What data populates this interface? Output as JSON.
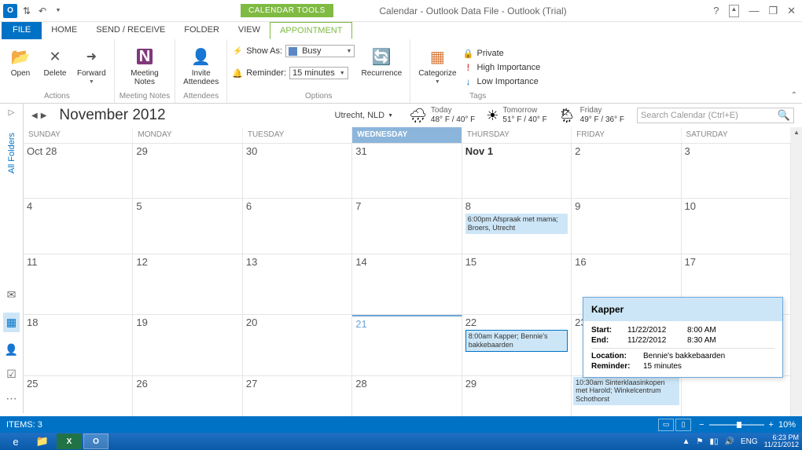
{
  "window": {
    "title": "Calendar - Outlook Data File - Outlook (Trial)",
    "context_tab": "CALENDAR TOOLS"
  },
  "tabs": {
    "file": "FILE",
    "home": "HOME",
    "send_receive": "SEND / RECEIVE",
    "folder": "FOLDER",
    "view": "VIEW",
    "appointment": "APPOINTMENT"
  },
  "ribbon": {
    "actions": {
      "open": "Open",
      "delete": "Delete",
      "forward": "Forward",
      "label": "Actions"
    },
    "meeting_notes": {
      "btn": "Meeting\nNotes",
      "label": "Meeting Notes"
    },
    "attendees": {
      "btn": "Invite\nAttendees",
      "label": "Attendees"
    },
    "options": {
      "show_as": "Show As:",
      "busy": "Busy",
      "reminder": "Reminder:",
      "minutes": "15 minutes",
      "recurrence": "Recurrence",
      "label": "Options"
    },
    "tags": {
      "categorize": "Categorize",
      "private": "Private",
      "high": "High Importance",
      "low": "Low Importance",
      "label": "Tags"
    }
  },
  "leftbar": {
    "all_folders": "All Folders"
  },
  "header": {
    "month": "November 2012",
    "location": "Utrecht, NLD",
    "weather": [
      {
        "label": "Today",
        "temp": "48° F / 40° F",
        "icon": "🌧"
      },
      {
        "label": "Tomorrow",
        "temp": "51° F / 40° F",
        "icon": "☀"
      },
      {
        "label": "Friday",
        "temp": "49° F / 36° F",
        "icon": "🌦"
      }
    ],
    "search_placeholder": "Search Calendar (Ctrl+E)"
  },
  "days": [
    "SUNDAY",
    "MONDAY",
    "TUESDAY",
    "WEDNESDAY",
    "THURSDAY",
    "FRIDAY",
    "SATURDAY"
  ],
  "today_col": 3,
  "grid": [
    [
      "Oct 28",
      "29",
      "30",
      "31",
      "Nov 1",
      "2",
      "3"
    ],
    [
      "4",
      "5",
      "6",
      "7",
      "8",
      "9",
      "10"
    ],
    [
      "11",
      "12",
      "13",
      "14",
      "15",
      "16",
      "17"
    ],
    [
      "18",
      "19",
      "20",
      "21",
      "22",
      "23",
      "24"
    ],
    [
      "25",
      "26",
      "27",
      "28",
      "29",
      "",
      ""
    ]
  ],
  "events": {
    "1_4": "6:00pm Afspraak met mama; Broers, Utrecht",
    "3_4": "8:00am Kapper; Bennie's bakkebaarden",
    "friday_23": "10:30am Sinterklaasinkopen met Harold; Winkelcentrum Schothorst"
  },
  "selected_cell": "3_4",
  "highlight_cell": "0_4",
  "preview": {
    "title": "Kapper",
    "start_l": "Start:",
    "start_d": "11/22/2012",
    "start_t": "8:00 AM",
    "end_l": "End:",
    "end_d": "11/22/2012",
    "end_t": "8:30 AM",
    "loc_l": "Location:",
    "loc_v": "Bennie's bakkebaarden",
    "rem_l": "Reminder:",
    "rem_v": "15 minutes"
  },
  "statusbar": {
    "items": "ITEMS: 3",
    "zoom": "10%"
  },
  "taskbar": {
    "lang": "ENG",
    "time": "6:23 PM",
    "date": "11/21/2012"
  }
}
